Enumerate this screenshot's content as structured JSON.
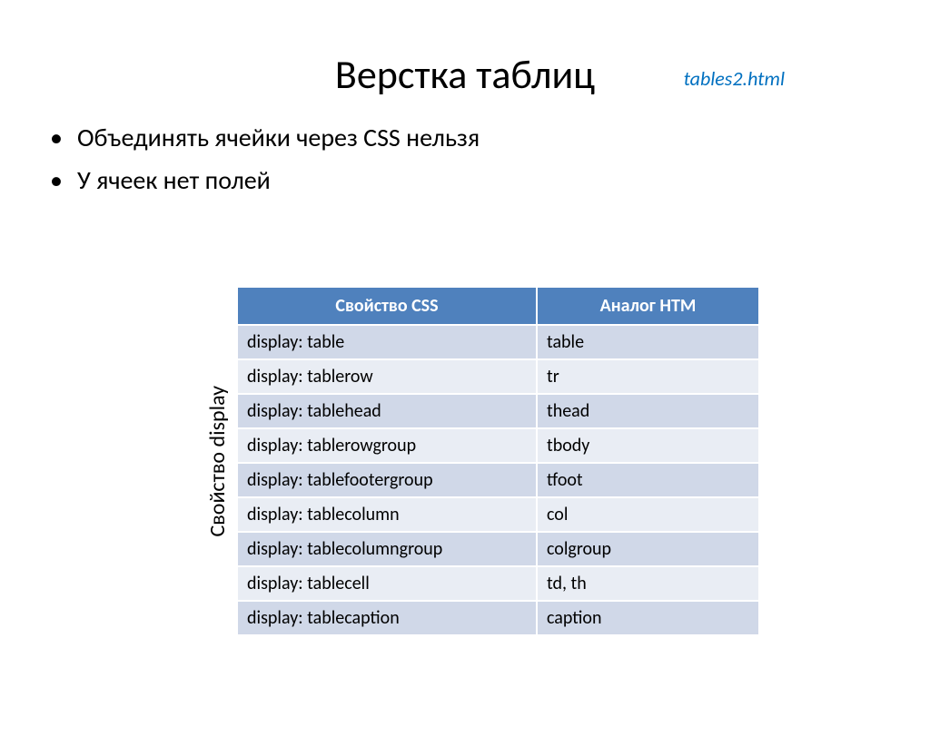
{
  "link_text": "tables2.html",
  "title": "Верстка таблиц",
  "bullets": [
    "Объединять ячейки через CSS нельзя",
    "У ячеек нет полей"
  ],
  "vertical_label": "Свойство display",
  "table": {
    "headers": [
      "Свойство CSS",
      "Аналог HTM"
    ],
    "rows": [
      [
        "display: table",
        "table"
      ],
      [
        "display: tablerow",
        "tr"
      ],
      [
        "display: tablehead",
        "thead"
      ],
      [
        "display: tablerowgroup",
        "tbody"
      ],
      [
        "display: tablefootergroup",
        "tfoot"
      ],
      [
        "display: tablecolumn",
        "col"
      ],
      [
        "display: tablecolumngroup",
        "colgroup"
      ],
      [
        "display: tablecell",
        "td, th"
      ],
      [
        "display: tablecaption",
        "caption"
      ]
    ]
  }
}
